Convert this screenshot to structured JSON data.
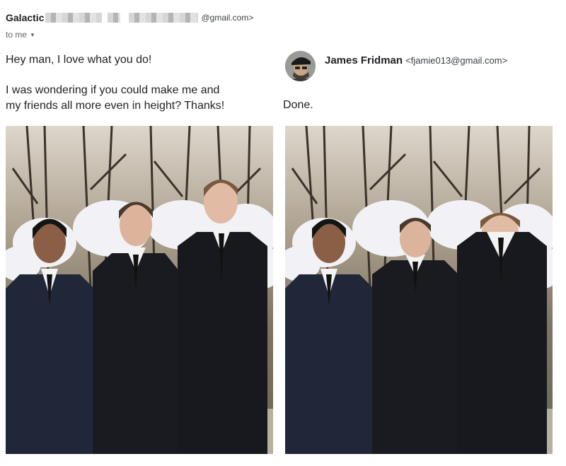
{
  "incoming": {
    "sender_name": "Galactic",
    "sender_email_visible": "@gmail.com>",
    "recipient_line": "to me",
    "greeting": "Hey man, I love what you do!",
    "request_line1": "I was wondering if you could make me and",
    "request_line2": "my friends all more even in height? Thanks!"
  },
  "reply": {
    "name": "James Fridman",
    "email": "<fjamie013@gmail.com>",
    "body": "Done."
  },
  "icons": {
    "recipient_dropdown": "caret-down-icon",
    "avatar": "user-avatar"
  },
  "colors": {
    "suit": "#1c1e26",
    "background_flowers": "#f1f1f4",
    "text": "#202124"
  }
}
